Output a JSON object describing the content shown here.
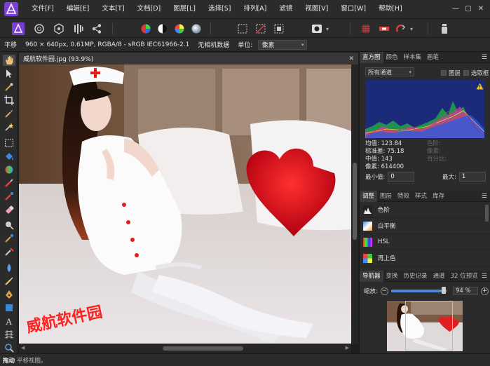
{
  "menu": [
    "文件[F]",
    "编辑[E]",
    "文本[T]",
    "文档[D]",
    "图层[L]",
    "选择[S]",
    "排列[A]",
    "滤镜",
    "视图[V]",
    "窗口[W]",
    "帮助[H]"
  ],
  "window_controls": {
    "minimize": "—",
    "maximize": "▢",
    "close": "✕"
  },
  "context_bar": {
    "tool": "平移",
    "doc_info": "960 × 640px, 0.61MP, RGBA/8 - sRGB IEC61966-2.1",
    "camera": "无相机数据",
    "unit_label": "单位:",
    "unit_value": "像素"
  },
  "document": {
    "tab_title": "威航软件园.jpg (93.9%)",
    "close": "✕",
    "watermark": "威航软件园"
  },
  "histogram_panel": {
    "tabs": [
      "直方图",
      "颜色",
      "样本集",
      "画笔"
    ],
    "channel": "所有通道",
    "checkbox_layer": "图层",
    "checkbox_selection": "选取框",
    "stats": [
      "均值: 123.84",
      "标准差: 75.18",
      "中值: 143",
      "像素: 614400"
    ],
    "stats_right": [
      "色阶:",
      "像素:",
      "百分比:"
    ],
    "min_label": "最小值:",
    "min_value": "0",
    "max_label": "最大:",
    "max_value": "1"
  },
  "adjustments_panel": {
    "tabs": [
      "调整",
      "图层",
      "特效",
      "样式",
      "库存"
    ],
    "items": [
      "色阶",
      "白平衡",
      "HSL",
      "再上色"
    ]
  },
  "navigator_panel": {
    "tabs": [
      "导航器",
      "变换",
      "历史记录",
      "通道",
      "32 位预览"
    ],
    "zoom_label": "缩放:",
    "zoom_value": "94 %",
    "zoom_fraction": 0.94
  },
  "status": {
    "bold": "拖动",
    "text": "平移视图。"
  },
  "colors": {
    "accent": "#4a8ad8",
    "logo": "#7b3fd6"
  }
}
